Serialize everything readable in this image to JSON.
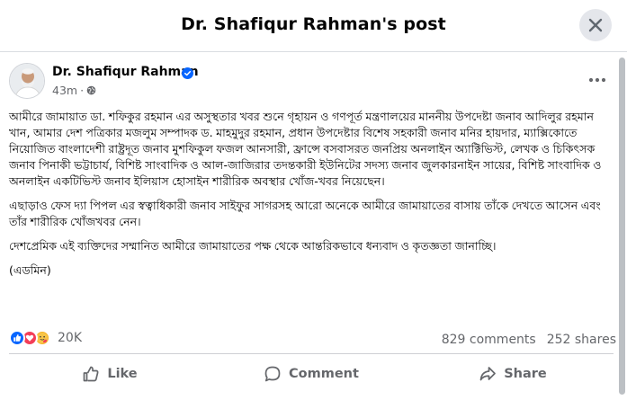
{
  "dialog": {
    "title": "Dr. Shafiqur Rahman's post"
  },
  "post": {
    "author": "Dr. Shafiqur Rahman",
    "time": "43m",
    "privacy_icon": "globe-icon",
    "paragraphs": [
      "আমীরে জামায়াত ডা. শফিকুর রহমান এর অসুস্থতার খবর শুনে গৃহায়ন ও গণপূর্ত মন্ত্রণালয়ের মাননীয় উপদেষ্টা জনাব আদিলুর রহমান খান, আমার দেশ পত্রিকার মজলুম সম্পাদক ড. মাহমুদুর রহমান, প্রধান উপদেষ্টার বিশেষ সহকারী জনাব মনির হায়দার, ম্যাক্সিকোতে নিয়োজিত বাংলাদেশী রাষ্ট্রদূত জনাব মুশফিকুল ফজল আনসারী, ফ্রান্সে বসবাসরত জনপ্রিয় অনলাইন অ্যাক্টিভিস্ট, লেখক ও চিকিৎসক জনাব পিনাকী ভট্টাচার্য, বিশিষ্ট সাংবাদিক ও আল-জাজিরার তদন্তকারী ইউনিটের সদস্য জনাব জুলকারনাইন সায়ের, বিশিষ্ট সাংবাদিক ও অনলাইন একটিভিস্ট জনাব ইলিয়াস হোসাইন শারীরিক অবস্থার খোঁজ-খবর নিয়েছেন।",
      "এছাড়াও ফেস দ্যা পিপল এর স্বত্বাধিকারী জনাব সাইফুর সাগরসহ আরো অনেকে আমীরে জামায়াতের বাসায় তাঁকে দেখতে আসেন এবং তাঁর শারীরিক খোঁজখবর নেন।",
      "দেশপ্রেমিক এই ব্যক্তিদের সম্মানিত আমীরে জামায়াতের পক্ষ থেকে আন্তরিকভাবে ধন্যবাদ ও কৃতজ্ঞতা জানাচ্ছি।",
      "(এডমিন)"
    ],
    "reactions": {
      "icons": [
        "like-icon",
        "love-icon",
        "care-icon"
      ],
      "count": "20K",
      "comments": "829 comments",
      "shares": "252 shares"
    },
    "actions": {
      "like": "Like",
      "comment": "Comment",
      "share": "Share"
    }
  },
  "colors": {
    "accent": "#0866ff",
    "muted": "#65676b",
    "love": "#f33e58",
    "care": "#f7b125"
  }
}
